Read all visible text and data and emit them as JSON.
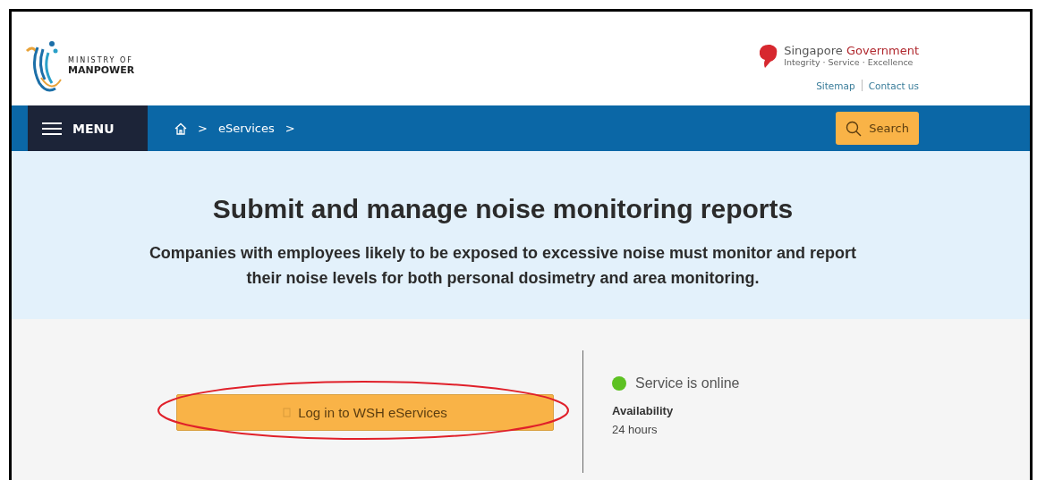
{
  "header": {
    "logo": {
      "line1": "MINISTRY OF",
      "line2": "MANPOWER"
    },
    "gov": {
      "name": "Singapore",
      "name_accent": "Government",
      "tagline": "Integrity · Service · Excellence"
    },
    "links": [
      "Sitemap",
      "Contact us"
    ]
  },
  "nav": {
    "menu": "MENU",
    "breadcrumb": [
      {
        "kind": "home"
      },
      {
        "kind": "separator",
        "label": ">"
      },
      {
        "kind": "link",
        "label": "eServices"
      },
      {
        "kind": "separator",
        "label": ">"
      }
    ],
    "search": "Search"
  },
  "hero": {
    "title": "Submit and manage noise monitoring reports",
    "description": "Companies with employees likely to be exposed to excessive noise must monitor and report their noise levels for both personal dosimetry and area monitoring."
  },
  "login": {
    "label": "Log in to WSH eServices",
    "highlighted": true
  },
  "status": {
    "text": "Service is online",
    "online": true,
    "availability_label": "Availability",
    "availability_value": "24 hours"
  }
}
